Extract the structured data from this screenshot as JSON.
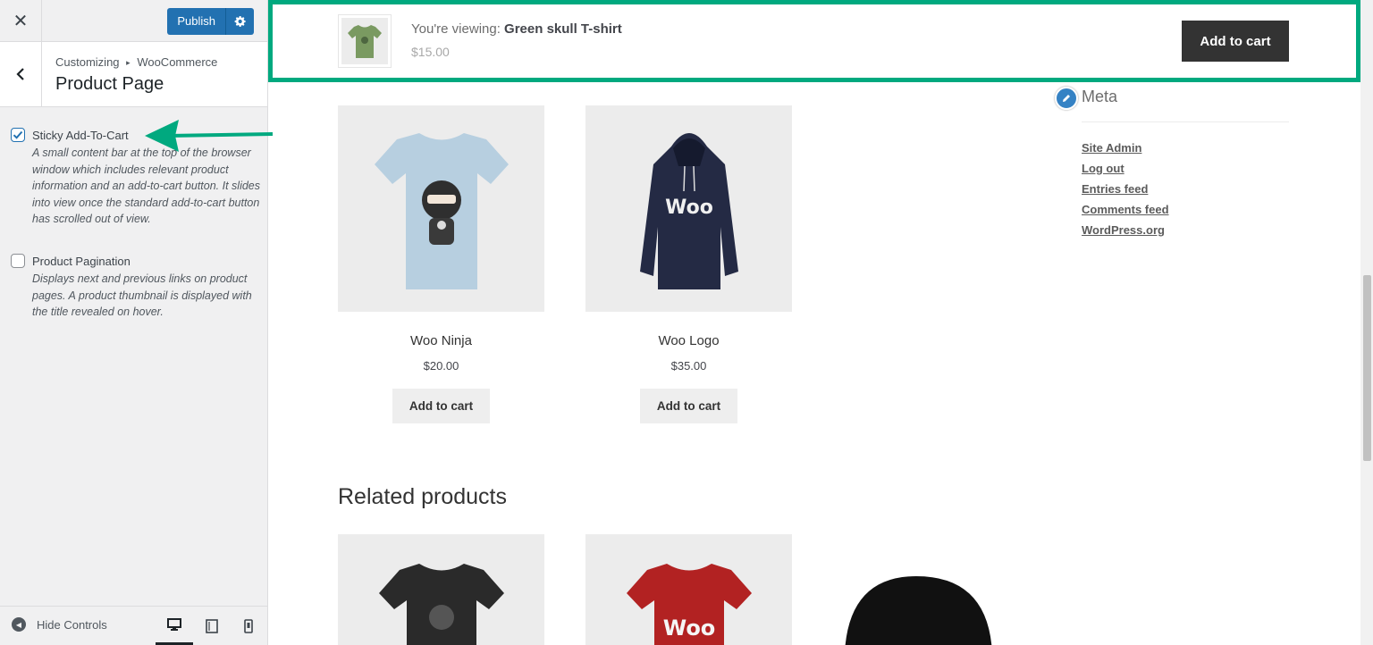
{
  "customizer": {
    "close_symbol": "✕",
    "publish_label": "Publish",
    "breadcrumb_root": "Customizing",
    "breadcrumb_sep": "▸",
    "breadcrumb_parent": "WooCommerce",
    "section_title": "Product Page",
    "controls": [
      {
        "label": "Sticky Add-To-Cart",
        "checked": true,
        "description": "A small content bar at the top of the browser window which includes relevant product information and an add-to-cart button. It slides into view once the standard add-to-cart button has scrolled out of view."
      },
      {
        "label": "Product Pagination",
        "checked": false,
        "description": "Displays next and previous links on product pages. A product thumbnail is displayed with the title revealed on hover."
      }
    ],
    "footer": {
      "hide_controls_label": "Hide Controls",
      "devices": [
        "desktop-icon",
        "tablet-icon",
        "mobile-icon"
      ],
      "active_device": "desktop"
    }
  },
  "annotation": {
    "highlight_color": "#00a97f"
  },
  "sticky_bar": {
    "viewing_prefix": "You're viewing:",
    "product_name": "Green skull T-shirt",
    "price": "$15.00",
    "button_label": "Add to cart"
  },
  "products": [
    {
      "name": "Woo Ninja",
      "price": "$20.00",
      "button_label": "Add to cart",
      "image": "light-blue-ninja-tshirt"
    },
    {
      "name": "Woo Logo",
      "price": "$35.00",
      "button_label": "Add to cart",
      "image": "navy-woo-hoodie"
    }
  ],
  "related": {
    "title": "Related products",
    "images": [
      "black-ninja-tshirt",
      "red-woo-tshirt",
      "black-beanie"
    ]
  },
  "meta_widget": {
    "title": "Meta",
    "links": [
      "Site Admin",
      "Log out",
      "Entries feed",
      "Comments feed",
      "WordPress.org"
    ]
  },
  "colors": {
    "accent_blue": "#2271b1",
    "highlight_green": "#00a97f",
    "dark_button": "#333333"
  }
}
